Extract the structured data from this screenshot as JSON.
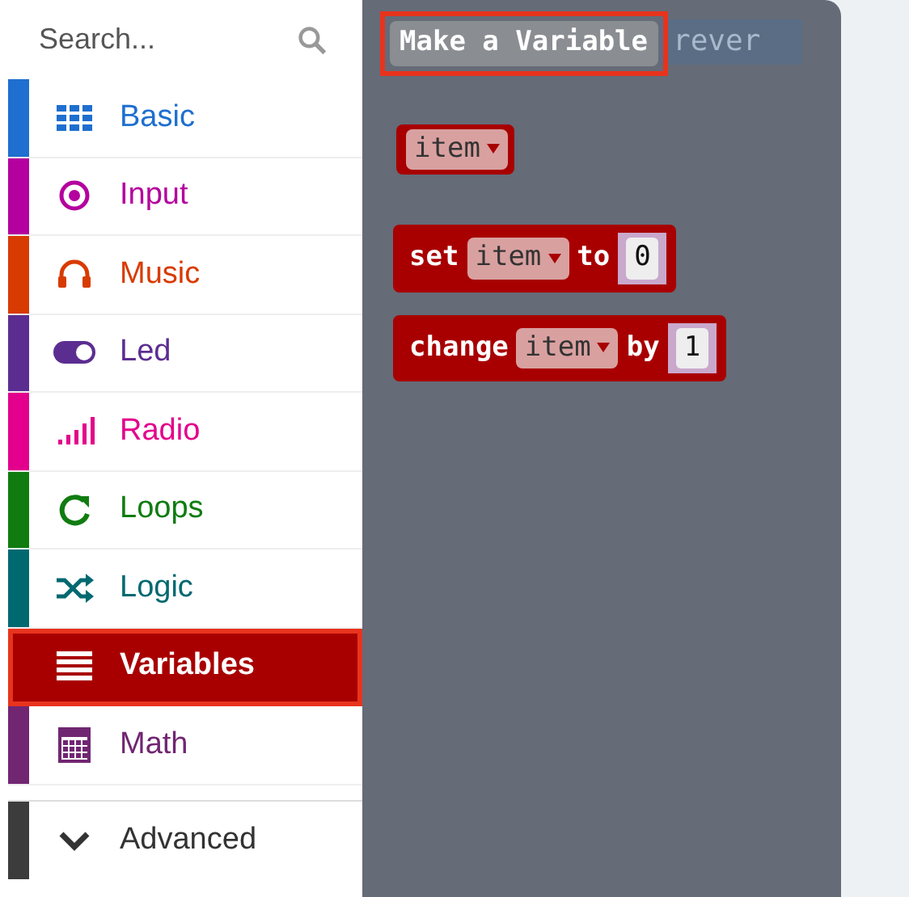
{
  "search": {
    "placeholder": "Search..."
  },
  "categories": [
    {
      "label": "Basic",
      "color": "#1e6fcf",
      "kind": "grid",
      "selected": false,
      "highlighted": false
    },
    {
      "label": "Input",
      "color": "#b4009e",
      "kind": "target",
      "selected": false,
      "highlighted": false
    },
    {
      "label": "Music",
      "color": "#d83b01",
      "kind": "headphones",
      "selected": false,
      "highlighted": false
    },
    {
      "label": "Led",
      "color": "#5c2d91",
      "kind": "toggle",
      "selected": false,
      "highlighted": false
    },
    {
      "label": "Radio",
      "color": "#e3008c",
      "kind": "signal",
      "selected": false,
      "highlighted": false
    },
    {
      "label": "Loops",
      "color": "#107c10",
      "kind": "loop",
      "selected": false,
      "highlighted": false
    },
    {
      "label": "Logic",
      "color": "#006970",
      "kind": "shuffle",
      "selected": false,
      "highlighted": false
    },
    {
      "label": "Variables",
      "color": "#a80000",
      "kind": "lines",
      "selected": true,
      "highlighted": true
    },
    {
      "label": "Math",
      "color": "#712672",
      "kind": "calculator",
      "selected": false,
      "highlighted": false
    }
  ],
  "advanced": {
    "label": "Advanced",
    "color": "#3c3c3c"
  },
  "flyout": {
    "button": {
      "label": "Make a Variable",
      "highlighted": true
    },
    "background_text": "rever",
    "blocks": [
      {
        "kind": "reporter",
        "parts": [
          {
            "kind": "dropdown",
            "text": "item"
          }
        ]
      },
      {
        "kind": "statement",
        "parts": [
          {
            "kind": "word",
            "text": "set"
          },
          {
            "kind": "dropdown",
            "text": "item"
          },
          {
            "kind": "word",
            "text": "to"
          },
          {
            "kind": "number",
            "text": "0"
          }
        ]
      },
      {
        "kind": "statement",
        "parts": [
          {
            "kind": "word",
            "text": "change"
          },
          {
            "kind": "dropdown",
            "text": "item"
          },
          {
            "kind": "word",
            "text": "by"
          },
          {
            "kind": "number",
            "text": "1"
          }
        ]
      }
    ]
  }
}
